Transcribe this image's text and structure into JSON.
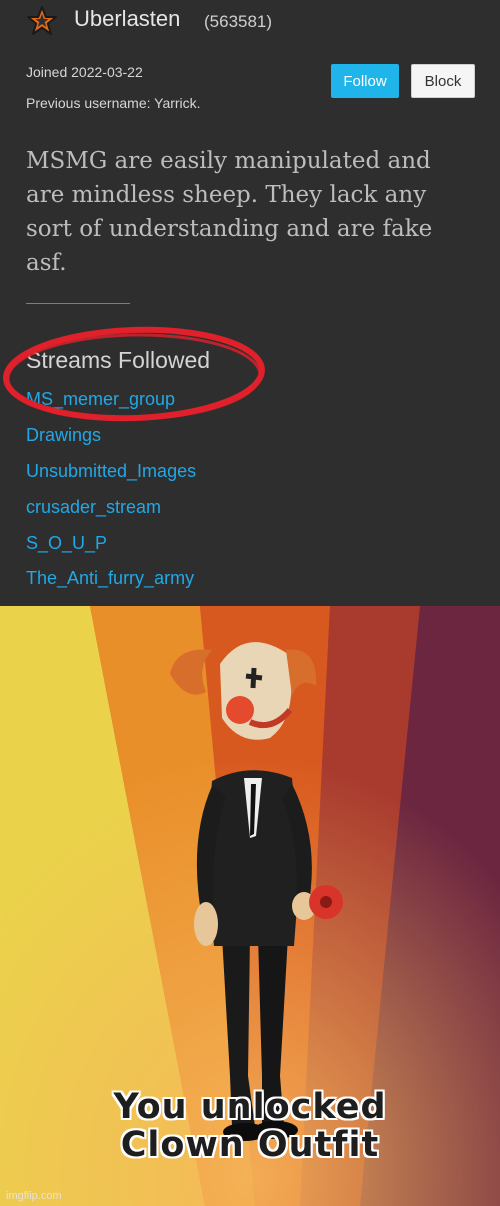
{
  "profile": {
    "username": "Uberlasten",
    "user_id": "(563581)",
    "joined": "Joined 2022-03-22",
    "previous_username": "Previous username: Yarrick.",
    "follow_label": "Follow",
    "block_label": "Block",
    "bio": "MSMG are easily manipulated and are mindless sheep. They lack any sort of understanding and are fake asf.",
    "streams_title": "Streams Followed",
    "streams": [
      "MS_memer_group",
      "Drawings",
      "Unsubmitted_Images",
      "crusader_stream",
      "S_O_U_P",
      "The_Anti_furry_army"
    ]
  },
  "meme": {
    "caption_line1": "You unlocked",
    "caption_line2": "Clown Outfit",
    "watermark": "imgflip.com"
  },
  "colors": {
    "accent": "#1fb4ea",
    "stream_link": "#21a8e6",
    "annotation_circle": "#e0202a"
  },
  "icons": {
    "user_badge": "star-icon",
    "meme_figure": "clown-figure"
  }
}
